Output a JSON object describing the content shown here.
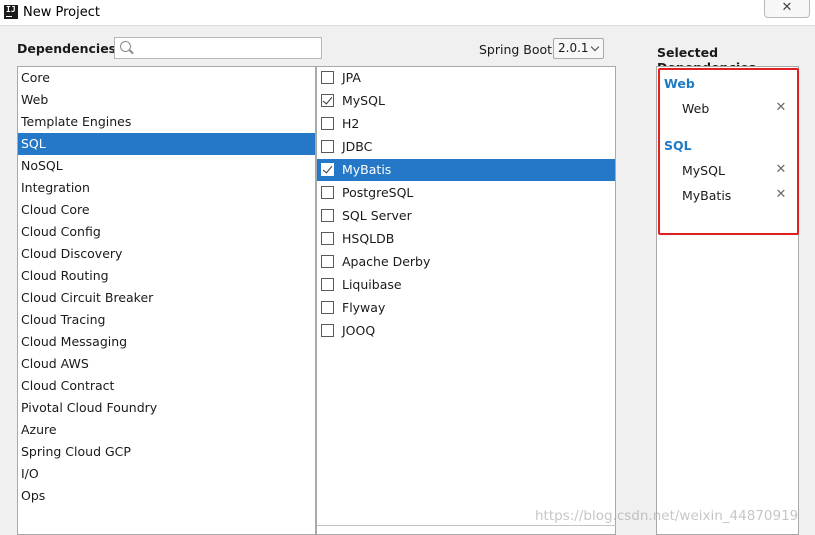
{
  "window": {
    "title": "New Project",
    "close_symbol": "✕"
  },
  "header": {
    "dependencies_label": "Dependencies",
    "search_value": "",
    "spring_boot_label": "Spring Boot",
    "spring_boot_version": "2.0.1"
  },
  "categories": [
    {
      "label": "Core"
    },
    {
      "label": "Web"
    },
    {
      "label": "Template Engines"
    },
    {
      "label": "SQL",
      "selected": true
    },
    {
      "label": "NoSQL"
    },
    {
      "label": "Integration"
    },
    {
      "label": "Cloud Core"
    },
    {
      "label": "Cloud Config"
    },
    {
      "label": "Cloud Discovery"
    },
    {
      "label": "Cloud Routing"
    },
    {
      "label": "Cloud Circuit Breaker"
    },
    {
      "label": "Cloud Tracing"
    },
    {
      "label": "Cloud Messaging"
    },
    {
      "label": "Cloud AWS"
    },
    {
      "label": "Cloud Contract"
    },
    {
      "label": "Pivotal Cloud Foundry"
    },
    {
      "label": "Azure"
    },
    {
      "label": "Spring Cloud GCP"
    },
    {
      "label": "I/O"
    },
    {
      "label": "Ops"
    }
  ],
  "options": [
    {
      "label": "JPA",
      "checked": false
    },
    {
      "label": "MySQL",
      "checked": true
    },
    {
      "label": "H2",
      "checked": false
    },
    {
      "label": "JDBC",
      "checked": false
    },
    {
      "label": "MyBatis",
      "checked": true,
      "selected": true
    },
    {
      "label": "PostgreSQL",
      "checked": false
    },
    {
      "label": "SQL Server",
      "checked": false
    },
    {
      "label": "HSQLDB",
      "checked": false
    },
    {
      "label": "Apache Derby",
      "checked": false
    },
    {
      "label": "Liquibase",
      "checked": false
    },
    {
      "label": "Flyway",
      "checked": false
    },
    {
      "label": "JOOQ",
      "checked": false
    }
  ],
  "selected_dependencies": {
    "title": "Selected Dependencies",
    "groups": [
      {
        "name": "Web",
        "items": [
          "Web"
        ]
      },
      {
        "name": "SQL",
        "items": [
          "MySQL",
          "MyBatis"
        ]
      }
    ],
    "remove_symbol": "✕"
  },
  "watermark": "https://blog.csdn.net/weixin_44870919",
  "colors": {
    "selection": "#2578c8",
    "group_title": "#1f7ac6",
    "highlight_box": "#e02020"
  }
}
